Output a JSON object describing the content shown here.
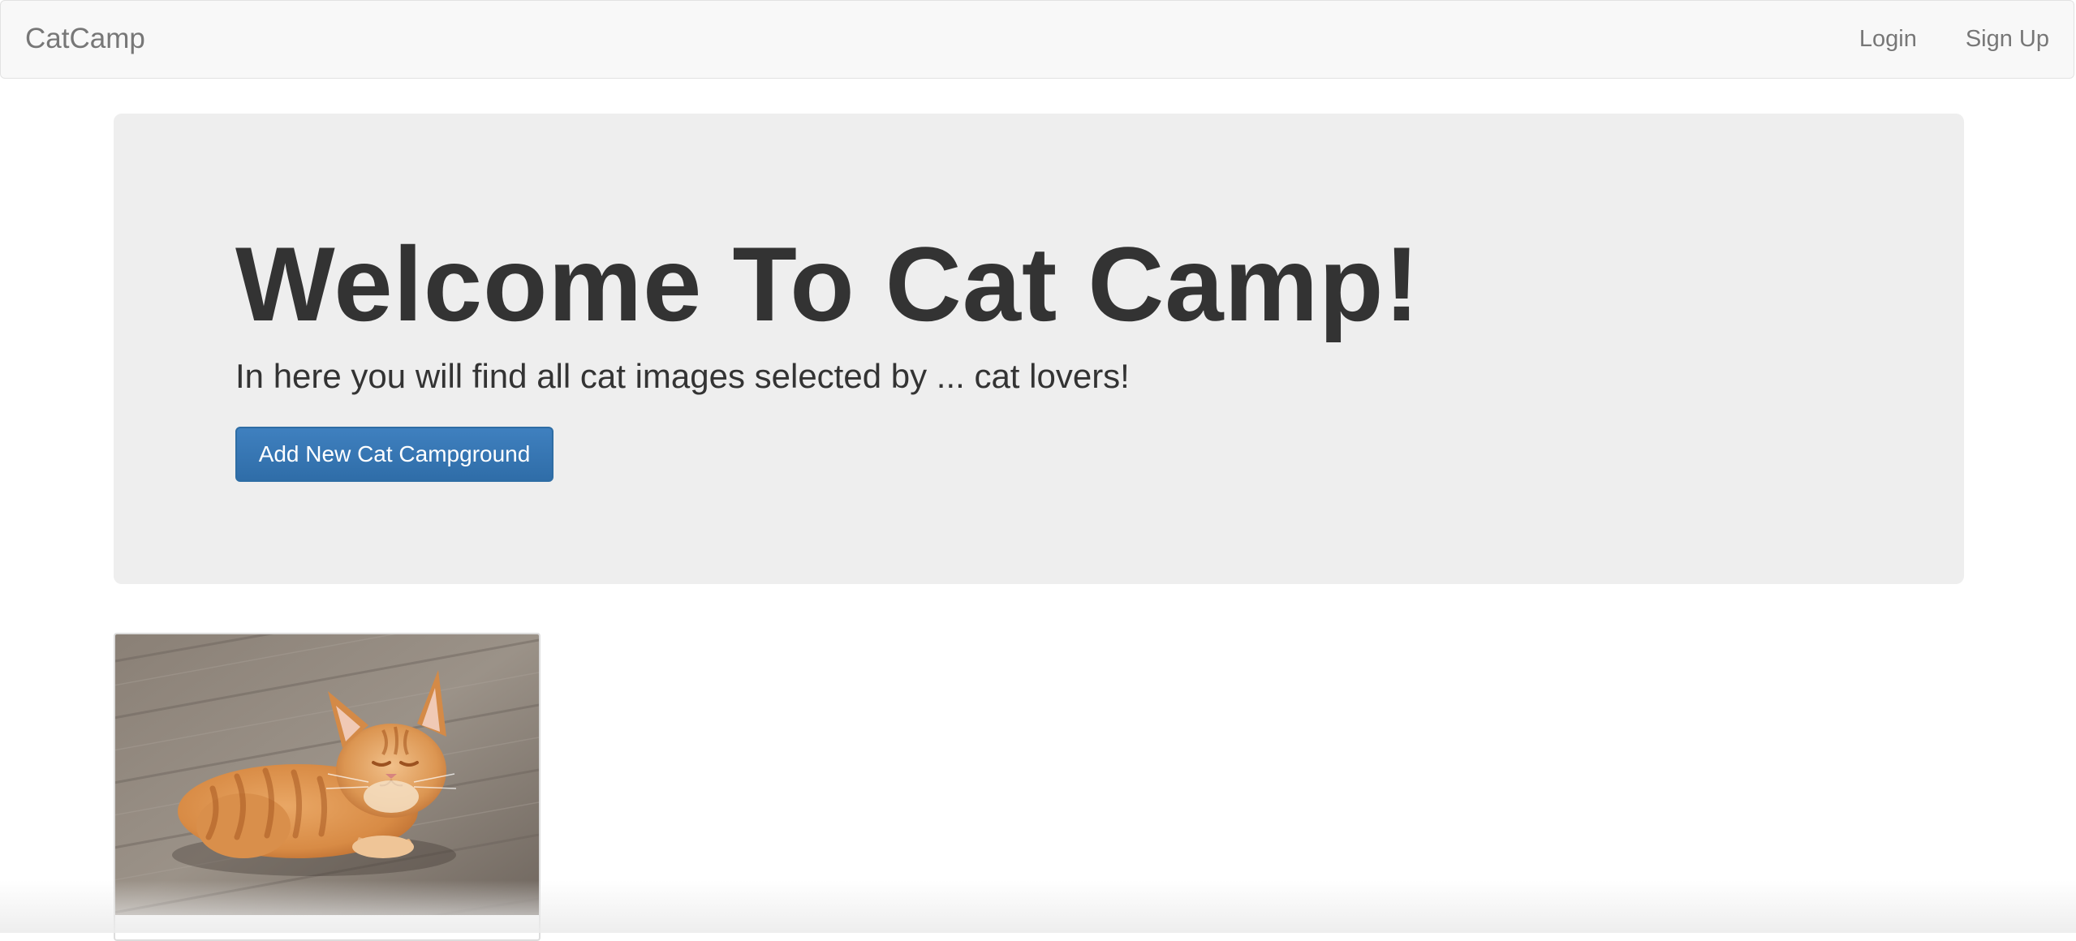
{
  "navbar": {
    "brand": "CatCamp",
    "links": [
      {
        "label": "Login"
      },
      {
        "label": "Sign Up"
      }
    ]
  },
  "corner_text": "}",
  "hero": {
    "title": "Welcome To Cat Camp!",
    "subtitle": "In here you will find all cat images selected by ... cat lovers!",
    "button_label": "Add New Cat Campground"
  },
  "campgrounds": [
    {
      "image_icon": "orange-tabby-cat-photo"
    }
  ],
  "colors": {
    "navbar_bg": "#f8f8f8",
    "jumbotron_bg": "#eeeeee",
    "primary_button": "#337ab7",
    "text": "#333333",
    "nav_text": "#777777"
  }
}
